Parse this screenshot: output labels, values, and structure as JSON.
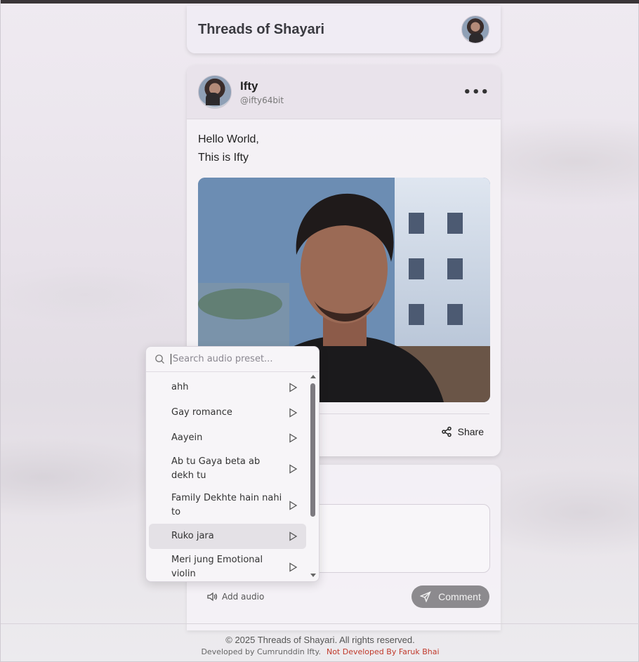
{
  "header": {
    "title": "Threads of Shayari"
  },
  "post": {
    "author_name": "Ifty",
    "author_handle": "@ifty64bit",
    "text_lines": [
      "Hello World,",
      "This is Ifty"
    ],
    "share_label": "Share"
  },
  "audio_dropdown": {
    "placeholder": "Search audio preset...",
    "items": [
      {
        "label": "ahh"
      },
      {
        "label": "Gay romance"
      },
      {
        "label": "Aayein"
      },
      {
        "label": "Ab tu Gaya beta ab dekh tu"
      },
      {
        "label": "Family Dekhte hain nahi to"
      },
      {
        "label": "Ruko jara"
      },
      {
        "label": "Meri jung Emotional violin"
      }
    ],
    "highlighted_item": "Ruko jara"
  },
  "comment": {
    "add_audio_label": "Add audio",
    "submit_label": "Comment"
  },
  "footer": {
    "copyright": "© 2025 Threads of Shayari. All rights reserved.",
    "developed_by": "Developed by Cumrunddin Ifty.",
    "not_developed_by": "Not Developed By Faruk Bhai"
  },
  "icons": {
    "search": "search-icon",
    "play": "play-icon",
    "share": "share-icon",
    "speaker": "speaker-icon",
    "send": "send-icon",
    "more": "more-icon"
  }
}
